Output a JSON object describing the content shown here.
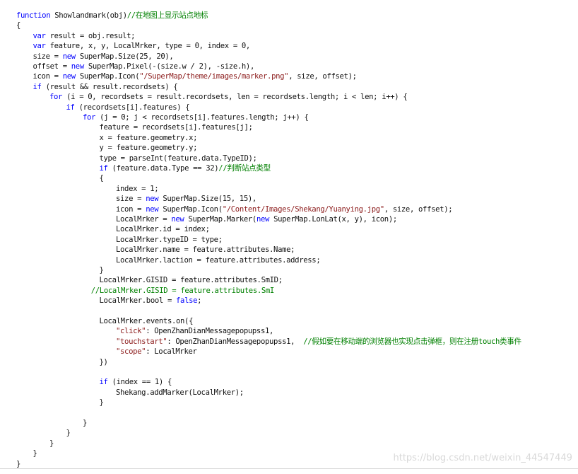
{
  "code": {
    "lines": [
      {
        "indent": 0,
        "tokens": [
          [
            "kw",
            "function"
          ],
          [
            "plain",
            " Showlandmark(obj)"
          ],
          [
            "cmt",
            "//在地图上显示站点地标"
          ]
        ]
      },
      {
        "indent": 0,
        "tokens": [
          [
            "plain",
            "{"
          ]
        ]
      },
      {
        "indent": 1,
        "tokens": [
          [
            "kw",
            "var"
          ],
          [
            "plain",
            " result = obj.result;"
          ]
        ]
      },
      {
        "indent": 1,
        "tokens": [
          [
            "kw",
            "var"
          ],
          [
            "plain",
            " feature, x, y, LocalMrker, type = 0, index = 0,"
          ]
        ]
      },
      {
        "indent": 1,
        "tokens": [
          [
            "plain",
            "size = "
          ],
          [
            "kw",
            "new"
          ],
          [
            "plain",
            " SuperMap.Size(25, 20),"
          ]
        ]
      },
      {
        "indent": 1,
        "tokens": [
          [
            "plain",
            "offset = "
          ],
          [
            "kw",
            "new"
          ],
          [
            "plain",
            " SuperMap.Pixel(-(size.w / 2), -size.h),"
          ]
        ]
      },
      {
        "indent": 1,
        "tokens": [
          [
            "plain",
            "icon = "
          ],
          [
            "kw",
            "new"
          ],
          [
            "plain",
            " SuperMap.Icon("
          ],
          [
            "str",
            "\"/SuperMap/theme/images/marker.png\""
          ],
          [
            "plain",
            ", size, offset);"
          ]
        ]
      },
      {
        "indent": 1,
        "tokens": [
          [
            "kw",
            "if"
          ],
          [
            "plain",
            " (result && result.recordsets) {"
          ]
        ]
      },
      {
        "indent": 2,
        "tokens": [
          [
            "kw",
            "for"
          ],
          [
            "plain",
            " (i = 0, recordsets = result.recordsets, len = recordsets.length; i < len; i++) {"
          ]
        ]
      },
      {
        "indent": 3,
        "tokens": [
          [
            "kw",
            "if"
          ],
          [
            "plain",
            " (recordsets[i].features) {"
          ]
        ]
      },
      {
        "indent": 4,
        "tokens": [
          [
            "kw",
            "for"
          ],
          [
            "plain",
            " (j = 0; j < recordsets[i].features.length; j++) {"
          ]
        ]
      },
      {
        "indent": 5,
        "tokens": [
          [
            "plain",
            "feature = recordsets[i].features[j];"
          ]
        ]
      },
      {
        "indent": 5,
        "tokens": [
          [
            "plain",
            "x = feature.geometry.x;"
          ]
        ]
      },
      {
        "indent": 5,
        "tokens": [
          [
            "plain",
            "y = feature.geometry.y;"
          ]
        ]
      },
      {
        "indent": 5,
        "tokens": [
          [
            "plain",
            "type = parseInt(feature.data.TypeID);"
          ]
        ]
      },
      {
        "indent": 5,
        "tokens": [
          [
            "kw",
            "if"
          ],
          [
            "plain",
            " (feature.data.Type == 32)"
          ],
          [
            "cmt",
            "//判断站点类型"
          ]
        ]
      },
      {
        "indent": 5,
        "tokens": [
          [
            "plain",
            "{"
          ]
        ]
      },
      {
        "indent": 6,
        "tokens": [
          [
            "plain",
            "index = 1;"
          ]
        ]
      },
      {
        "indent": 6,
        "tokens": [
          [
            "plain",
            "size = "
          ],
          [
            "kw",
            "new"
          ],
          [
            "plain",
            " SuperMap.Size(15, 15),"
          ]
        ]
      },
      {
        "indent": 6,
        "tokens": [
          [
            "plain",
            "icon = "
          ],
          [
            "kw",
            "new"
          ],
          [
            "plain",
            " SuperMap.Icon("
          ],
          [
            "str",
            "\"/Content/Images/Shekang/Yuanying.jpg\""
          ],
          [
            "plain",
            ", size, offset);"
          ]
        ]
      },
      {
        "indent": 6,
        "tokens": [
          [
            "plain",
            "LocalMrker = "
          ],
          [
            "kw",
            "new"
          ],
          [
            "plain",
            " SuperMap.Marker("
          ],
          [
            "kw",
            "new"
          ],
          [
            "plain",
            " SuperMap.LonLat(x, y), icon);"
          ]
        ]
      },
      {
        "indent": 6,
        "tokens": [
          [
            "plain",
            "LocalMrker.id = index;"
          ]
        ]
      },
      {
        "indent": 6,
        "tokens": [
          [
            "plain",
            "LocalMrker.typeID = type;"
          ]
        ]
      },
      {
        "indent": 6,
        "tokens": [
          [
            "plain",
            "LocalMrker.name = feature.attributes.Name;"
          ]
        ]
      },
      {
        "indent": 6,
        "tokens": [
          [
            "plain",
            "LocalMrker.laction = feature.attributes.address;"
          ]
        ]
      },
      {
        "indent": 5,
        "tokens": [
          [
            "plain",
            "}"
          ]
        ]
      },
      {
        "indent": 5,
        "tokens": [
          [
            "plain",
            "LocalMrker.GISID = feature.attributes.SmID;"
          ]
        ]
      },
      {
        "indent": 4.5,
        "tokens": [
          [
            "cmt",
            "//LocalMrker.GISID = feature.attributes.SmI"
          ]
        ]
      },
      {
        "indent": 5,
        "tokens": [
          [
            "plain",
            "LocalMrker.bool = "
          ],
          [
            "kw",
            "false"
          ],
          [
            "plain",
            ";"
          ]
        ]
      },
      {
        "indent": 0,
        "tokens": []
      },
      {
        "indent": 5,
        "tokens": [
          [
            "plain",
            "LocalMrker.events.on({"
          ]
        ]
      },
      {
        "indent": 6,
        "tokens": [
          [
            "str",
            "\"click\""
          ],
          [
            "plain",
            ": OpenZhanDianMessagepopupss1,"
          ]
        ]
      },
      {
        "indent": 6,
        "tokens": [
          [
            "str",
            "\"touchstart\""
          ],
          [
            "plain",
            ": OpenZhanDianMessagepopupss1,  "
          ],
          [
            "cmt",
            "//假如要在移动端的浏览器也实现点击弹框，则在注册touch类事件"
          ]
        ]
      },
      {
        "indent": 6,
        "tokens": [
          [
            "str",
            "\"scope\""
          ],
          [
            "plain",
            ": LocalMrker"
          ]
        ]
      },
      {
        "indent": 5,
        "tokens": [
          [
            "plain",
            "})"
          ]
        ]
      },
      {
        "indent": 0,
        "tokens": []
      },
      {
        "indent": 5,
        "tokens": [
          [
            "kw",
            "if"
          ],
          [
            "plain",
            " (index == 1) {"
          ]
        ]
      },
      {
        "indent": 6,
        "tokens": [
          [
            "plain",
            "Shekang.addMarker(LocalMrker);"
          ]
        ]
      },
      {
        "indent": 5,
        "tokens": [
          [
            "plain",
            "}"
          ]
        ]
      },
      {
        "indent": 0,
        "tokens": []
      },
      {
        "indent": 4,
        "tokens": [
          [
            "plain",
            "}"
          ]
        ]
      },
      {
        "indent": 3,
        "tokens": [
          [
            "plain",
            "}"
          ]
        ]
      },
      {
        "indent": 2,
        "tokens": [
          [
            "plain",
            "}"
          ]
        ]
      },
      {
        "indent": 1,
        "tokens": [
          [
            "plain",
            "}"
          ]
        ]
      },
      {
        "indent": 0,
        "tokens": [
          [
            "plain",
            "}"
          ]
        ]
      }
    ]
  },
  "watermark": "https://blog.csdn.net/weixin_44547449",
  "colors": {
    "keyword": "#0000ff",
    "string": "#8b1a1a",
    "comment": "#008000",
    "text": "#111111",
    "watermark": "#d9d9d9"
  }
}
